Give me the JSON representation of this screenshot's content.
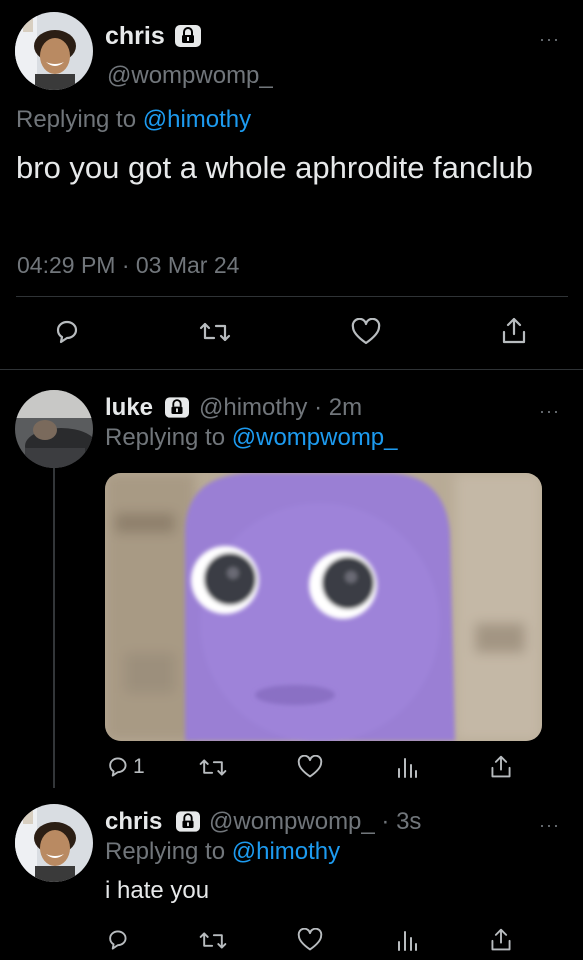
{
  "main_tweet": {
    "display_name": "chris",
    "handle": "@wompwomp_",
    "replying_prefix": "Replying to",
    "replying_handle": "@himothy",
    "text": "bro you got a whole aphrodite fanclub",
    "timestamp": "04:29 PM · 03 Mar 24",
    "more": "···"
  },
  "reply_1": {
    "display_name": "luke",
    "handle": "@himothy",
    "time": "· 2m",
    "replying_prefix": "Replying to",
    "replying_handle": "@wompwomp_",
    "reply_count": "1",
    "more": "···"
  },
  "reply_2": {
    "display_name": "chris",
    "handle": "@wompwomp_",
    "time": "· 3s",
    "replying_prefix": "Replying to",
    "replying_handle": "@himothy",
    "text": "i hate you",
    "more": "···"
  },
  "colors": {
    "background": "#000000",
    "link": "#1d9bf0",
    "muted": "#71767b",
    "text": "#e7e9ea"
  }
}
